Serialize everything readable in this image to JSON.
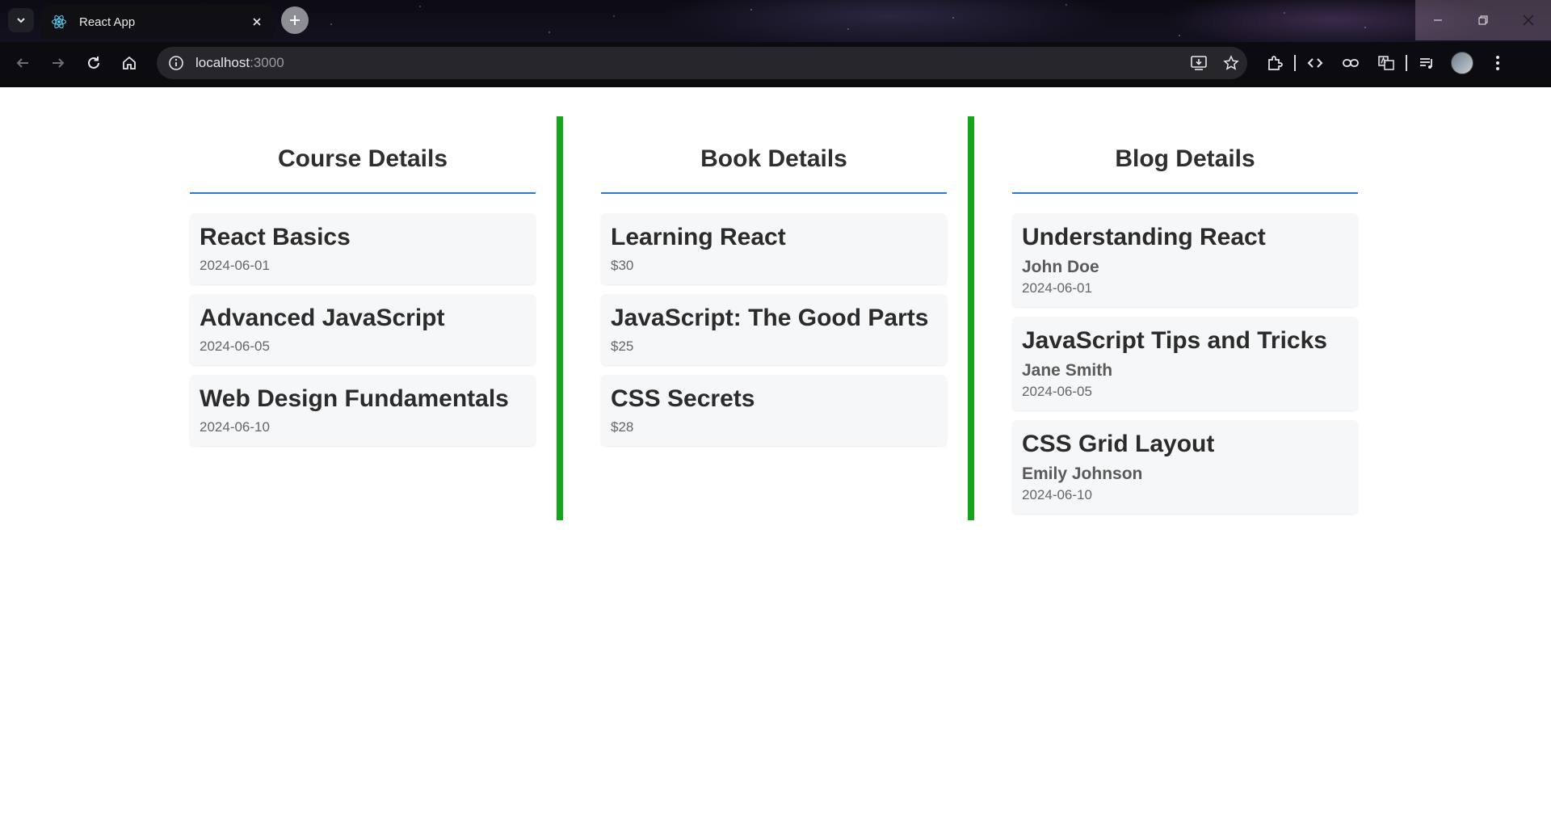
{
  "browser": {
    "tab_title": "React App",
    "url_host": "localhost",
    "url_port": ":3000",
    "icons": {
      "tab_list": "chevron-down-icon",
      "favicon": "react-logo-icon",
      "tab_close": "close-icon",
      "new_tab": "plus-icon",
      "back": "arrow-left-icon",
      "forward": "arrow-right-icon",
      "reload": "reload-icon",
      "home": "home-icon",
      "site_info": "info-icon",
      "install": "install-app-icon",
      "bookmark": "star-icon",
      "extensions": "puzzle-icon",
      "devtools": "code-icon",
      "link": "link-icon",
      "translate": "translate-icon",
      "media": "media-queue-icon",
      "profile": "avatar",
      "menu": "kebab-menu-icon"
    }
  },
  "page": {
    "accent_color": "#2b7bd6",
    "divider_color": "#14a51a",
    "courses": {
      "heading": "Course Details",
      "items": [
        {
          "title": "React Basics",
          "date": "2024-06-01"
        },
        {
          "title": "Advanced JavaScript",
          "date": "2024-06-05"
        },
        {
          "title": "Web Design Fundamentals",
          "date": "2024-06-10"
        }
      ]
    },
    "books": {
      "heading": "Book Details",
      "items": [
        {
          "title": "Learning React",
          "price": "$30"
        },
        {
          "title": "JavaScript: The Good Parts",
          "price": "$25"
        },
        {
          "title": "CSS Secrets",
          "price": "$28"
        }
      ]
    },
    "blogs": {
      "heading": "Blog Details",
      "items": [
        {
          "title": "Understanding React",
          "author": "John Doe",
          "date": "2024-06-01"
        },
        {
          "title": "JavaScript Tips and Tricks",
          "author": "Jane Smith",
          "date": "2024-06-05"
        },
        {
          "title": "CSS Grid Layout",
          "author": "Emily Johnson",
          "date": "2024-06-10"
        }
      ]
    }
  }
}
